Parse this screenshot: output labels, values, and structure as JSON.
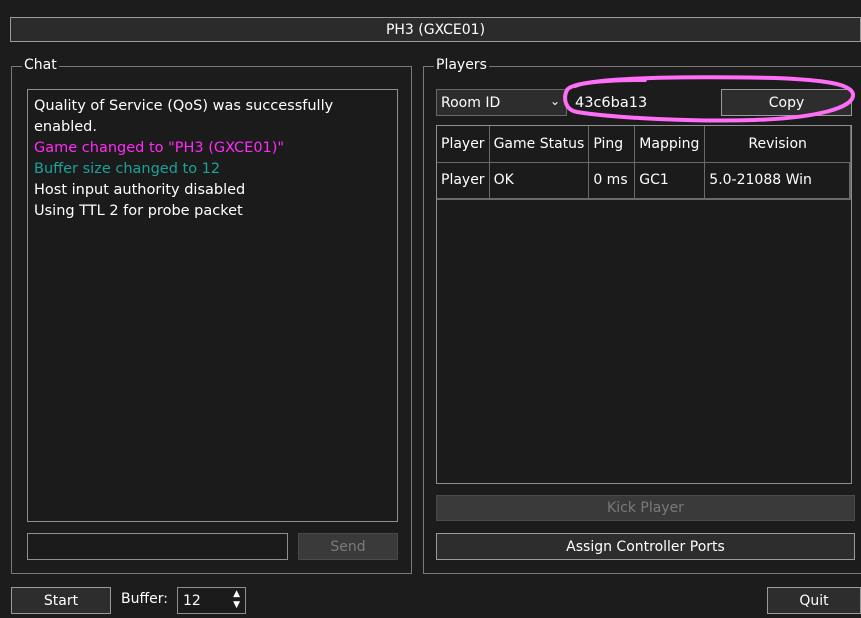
{
  "window": {
    "title": "PH3 (GXCE01)"
  },
  "chat": {
    "group_label": "Chat",
    "messages": [
      {
        "text": "Quality of Service (QoS) was successfully",
        "color": "#ffffff"
      },
      {
        "text": "enabled.",
        "color": "#ffffff"
      },
      {
        "text": "Game changed to \"PH3 (GXCE01)\"",
        "color": "#ff2bf5"
      },
      {
        "text": "Buffer size changed to 12",
        "color": "#1aa39a"
      },
      {
        "text": "Host input authority disabled",
        "color": "#ffffff"
      },
      {
        "text": "Using TTL 2 for probe packet",
        "color": "#ffffff"
      }
    ],
    "input_value": "",
    "send_label": "Send"
  },
  "players": {
    "group_label": "Players",
    "room_select": "Room ID",
    "room_value": "43c6ba13",
    "copy_label": "Copy",
    "columns": [
      "Player",
      "Game Status",
      "Ping",
      "Mapping",
      "Revision"
    ],
    "rows": [
      [
        "Player",
        "OK",
        "0 ms",
        "GC1",
        "5.0-21088 Win"
      ]
    ],
    "kick_label": "Kick Player",
    "assign_label": "Assign Controller Ports"
  },
  "bottom": {
    "start_label": "Start",
    "buffer_label": "Buffer:",
    "buffer_value": "12",
    "quit_label": "Quit"
  },
  "colors": {
    "annotation": "#ff6ef7",
    "background": "#1c1c1c"
  }
}
